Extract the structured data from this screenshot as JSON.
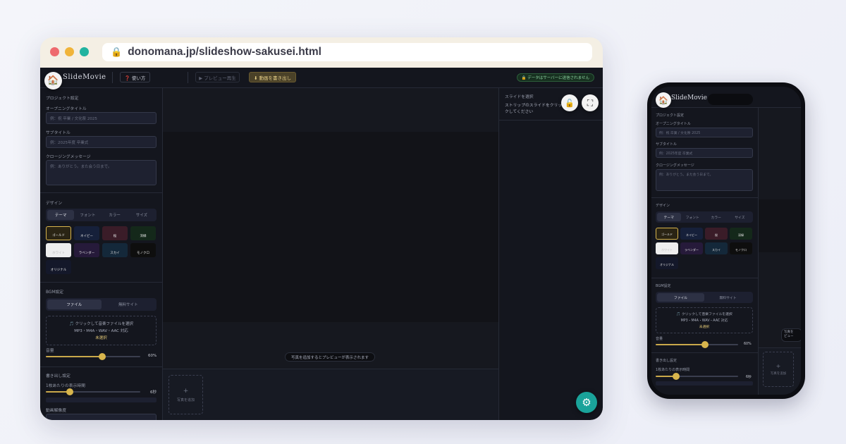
{
  "browser": {
    "url": "donomana.jp/slideshow-sakusei.html"
  },
  "app": {
    "brand": "SlideMovie",
    "help_label": "❓ 使い方",
    "preview_label": "▶ プレビュー再生",
    "export_label": "⬇ 動画を書き出し",
    "privacy_badge": "🔒 データはサーバーに送信されません"
  },
  "project": {
    "section": "プロジェクト設定",
    "opening_label": "オープニングタイトル",
    "opening_placeholder": "例：祝 卒業 / 文化祭 2025",
    "subtitle_label": "サブタイトル",
    "subtitle_placeholder": "例：2025年度 卒業式",
    "closing_label": "クロージングメッセージ",
    "closing_placeholder": "例：ありがとう。また会う日まで。"
  },
  "design": {
    "section": "デザイン",
    "tabs": [
      "テーマ",
      "フォント",
      "カラー",
      "サイズ"
    ],
    "themes": [
      {
        "label": "ゴールド",
        "color": "#2a2414"
      },
      {
        "label": "ネイビー",
        "color": "#16203a"
      },
      {
        "label": "桜",
        "color": "#3a1c28"
      },
      {
        "label": "深緑",
        "color": "#14281a"
      },
      {
        "label": "ホワイト",
        "color": "#eeeeee"
      },
      {
        "label": "ラベンダー",
        "color": "#261a3a"
      },
      {
        "label": "スカイ",
        "color": "#14283a"
      },
      {
        "label": "モノクロ",
        "color": "#0e0e0e"
      },
      {
        "label": "オリジナル",
        "color": "#14182a"
      }
    ]
  },
  "bgm": {
    "section": "BGM設定",
    "tabs": [
      "ファイル",
      "無料サイト"
    ],
    "drop_line1": "🎵 クリックして音楽ファイルを選択",
    "drop_line2": "MP3・M4A・WAV・AAC 対応",
    "status": "未選択",
    "volume_label": "音量",
    "volume_value": "60%",
    "volume": 0.6
  },
  "export": {
    "section": "書き出し設定",
    "duration_label": "1枚あたりの表示時間",
    "duration_value": "6秒",
    "duration": 0.25,
    "resolution_label": "動画解像度"
  },
  "preview": {
    "hint": "写真を追加するとプレビューが表示されます",
    "add_photo": "写真を追加"
  },
  "slide_panel": {
    "title": "スライドを選択",
    "desc": "ストリップのスライドをクリックしてください"
  },
  "phone": {
    "brand": "SlideMovie",
    "hint": "写真を\nピュー",
    "add_photo": "写真を追加",
    "duration_value": "6秒"
  },
  "colors": {
    "accent_gold": "#c9a84a",
    "settings_fab": "#1aa39a",
    "traffic_red": "#ee6a6e",
    "traffic_yellow": "#f0b43a",
    "traffic_green": "#21b3a0"
  }
}
